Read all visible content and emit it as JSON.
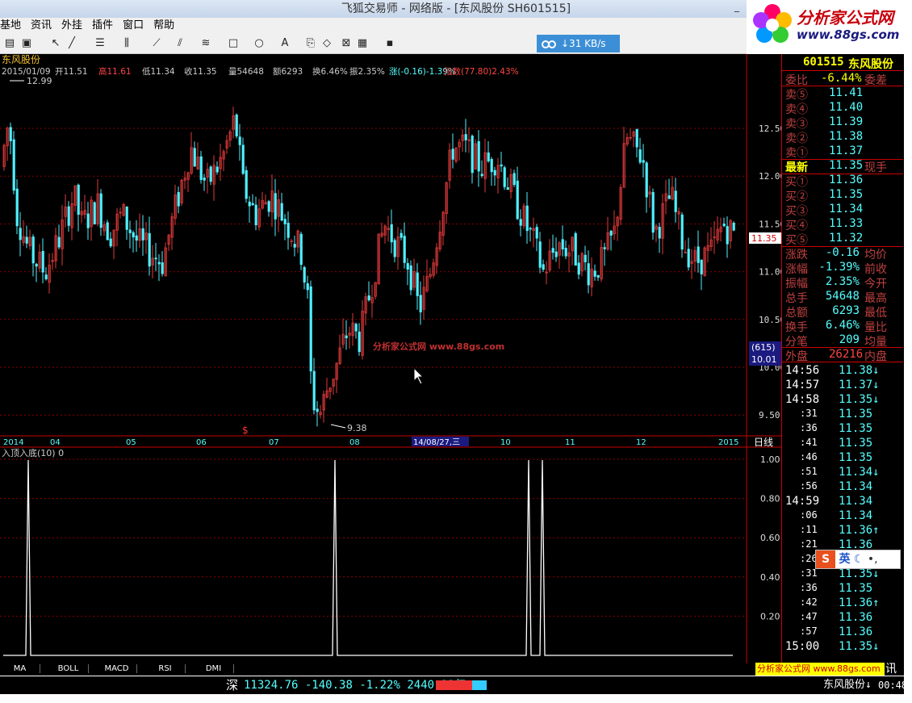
{
  "window": {
    "title": "飞狐交易师 - 网络版 - [东风股份 SH601515]",
    "min": "_"
  },
  "logo": {
    "name": "分析家公式网",
    "url": "www.88gs.com"
  },
  "menu": [
    "基地",
    "资讯",
    "外挂",
    "插件",
    "窗口",
    "帮助"
  ],
  "speed": "↓31 KB/s",
  "stock": {
    "name": "东风股份",
    "code": "601515",
    "info": {
      "date": "2015/01/09",
      "open": "开11.51",
      "high": "高11.61",
      "low": "低11.34",
      "close": "收11.35",
      "vol": "量54648",
      "amt": "额6293",
      "turn": "换6.46%",
      "amp": "振2.35%",
      "chg": "涨(-0.16)-1.39%",
      "index": "指数(77.80)2.43%"
    }
  },
  "chart": {
    "high_label": "12.99",
    "low_label": "9.38",
    "price_ticks": [
      "12.50",
      "12.00",
      "11.50",
      "11.00",
      "10.50",
      "10.00",
      "9.50"
    ],
    "current_price": "11.35",
    "mark1": "(615)",
    "mark2": "10.01",
    "dates": [
      "2014",
      "04",
      "05",
      "06",
      "07",
      "08",
      "14/08/27,三",
      "10",
      "11",
      "12",
      "2015"
    ],
    "period": "日线",
    "watermark": "分析家公式网 www.88gs.com",
    "dollar": "$"
  },
  "indicator": {
    "title": "入顶入底(10) 0",
    "ticks": [
      "1.00",
      "0.80",
      "0.60",
      "0.40",
      "0.20"
    ]
  },
  "tabs": [
    "MA",
    "BOLL",
    "MACD",
    "RSI",
    "DMI"
  ],
  "panel": {
    "header_code": "601515",
    "header_name": "东风股份",
    "weibi_label": "委比",
    "weibi": "-6.44%",
    "weicha_label": "委差",
    "sells": [
      {
        "l": "卖⑤",
        "p": "11.41"
      },
      {
        "l": "卖④",
        "p": "11.40"
      },
      {
        "l": "卖③",
        "p": "11.39"
      },
      {
        "l": "卖②",
        "p": "11.38"
      },
      {
        "l": "卖①",
        "p": "11.37"
      }
    ],
    "latest_label": "最新",
    "latest": "11.35",
    "xianshou": "现手",
    "buys": [
      {
        "l": "买①",
        "p": "11.36"
      },
      {
        "l": "买②",
        "p": "11.35"
      },
      {
        "l": "买③",
        "p": "11.34"
      },
      {
        "l": "买④",
        "p": "11.33"
      },
      {
        "l": "买⑤",
        "p": "11.32"
      }
    ],
    "stats": [
      {
        "l": "涨跌",
        "v": "-0.16",
        "r": "均价"
      },
      {
        "l": "涨幅",
        "v": "-1.39%",
        "r": "前收"
      },
      {
        "l": "振幅",
        "v": "2.35%",
        "r": "今开"
      },
      {
        "l": "总手",
        "v": "54648",
        "r": "最高"
      },
      {
        "l": "总额",
        "v": "6293",
        "r": "最低"
      },
      {
        "l": "换手",
        "v": "6.46%",
        "r": "量比"
      },
      {
        "l": "分笔",
        "v": "209",
        "r": "均量"
      }
    ],
    "outer_label": "外盘",
    "outer": "26216",
    "inner_label": "内盘",
    "ticks": [
      {
        "t": "14:56",
        "p": "11.38↓"
      },
      {
        "t": "14:57",
        "p": "11.37↓"
      },
      {
        "t": "14:58",
        "p": "11.35↓"
      },
      {
        "t": ":31",
        "p": "11.35"
      },
      {
        "t": ":36",
        "p": "11.35"
      },
      {
        "t": ":41",
        "p": "11.35"
      },
      {
        "t": ":46",
        "p": "11.35"
      },
      {
        "t": ":51",
        "p": "11.34↓"
      },
      {
        "t": ":56",
        "p": "11.34"
      },
      {
        "t": "14:59",
        "p": "11.34"
      },
      {
        "t": ":06",
        "p": "11.34"
      },
      {
        "t": ":11",
        "p": "11.36↑"
      },
      {
        "t": ":21",
        "p": "11.36"
      },
      {
        "t": ":26",
        "p": ""
      },
      {
        "t": ":31",
        "p": "11.35↓"
      },
      {
        "t": ":36",
        "p": "11.35"
      },
      {
        "t": ":42",
        "p": "11.36↑"
      },
      {
        "t": ":47",
        "p": "11.36"
      },
      {
        "t": ":57",
        "p": "11.36"
      },
      {
        "t": "15:00",
        "p": "11.35↓"
      }
    ]
  },
  "status": {
    "market": "深",
    "index": "11324.76",
    "chg": "-140.38",
    "pct": "-1.22%",
    "amt": "2440.33亿",
    "stock": "东风股份↓",
    "time": "00:48",
    "xun": "讯"
  },
  "ime": "英",
  "colors": {
    "up": "#e03a3a",
    "down": "#4ff0ff",
    "grid": "#8b0000"
  },
  "chart_data": {
    "type": "candlestick",
    "ylim": [
      9.3,
      13.1
    ]
  }
}
